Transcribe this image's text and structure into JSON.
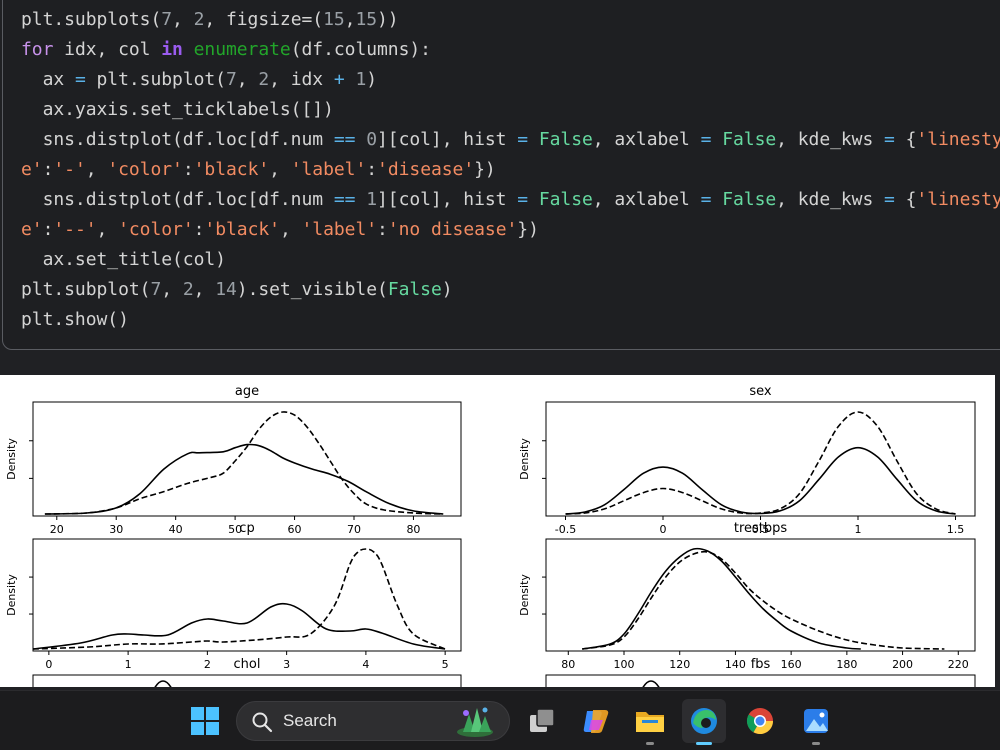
{
  "code_cell": {
    "lines": [
      [
        {
          "t": "plt.subplots(",
          "c": ""
        },
        {
          "t": "7",
          "c": "num"
        },
        {
          "t": ", ",
          "c": ""
        },
        {
          "t": "2",
          "c": "num"
        },
        {
          "t": ", figsize=(",
          "c": ""
        },
        {
          "t": "15",
          "c": "num"
        },
        {
          "t": ",",
          "c": ""
        },
        {
          "t": "15",
          "c": "num"
        },
        {
          "t": "))",
          "c": ""
        }
      ],
      [
        {
          "t": "for",
          "c": "kw"
        },
        {
          "t": " idx, col ",
          "c": ""
        },
        {
          "t": "in",
          "c": "kw2"
        },
        {
          "t": " ",
          "c": ""
        },
        {
          "t": "enumerate",
          "c": "bi"
        },
        {
          "t": "(df.columns):",
          "c": ""
        }
      ],
      [
        {
          "t": "  ax ",
          "c": ""
        },
        {
          "t": "=",
          "c": "op"
        },
        {
          "t": " plt.subplot(",
          "c": ""
        },
        {
          "t": "7",
          "c": "num"
        },
        {
          "t": ", ",
          "c": ""
        },
        {
          "t": "2",
          "c": "num"
        },
        {
          "t": ", idx ",
          "c": ""
        },
        {
          "t": "+",
          "c": "op"
        },
        {
          "t": " ",
          "c": ""
        },
        {
          "t": "1",
          "c": "num"
        },
        {
          "t": ")",
          "c": ""
        }
      ],
      [
        {
          "t": "  ax.yaxis.set_ticklabels([])",
          "c": ""
        }
      ],
      [
        {
          "t": "  sns.distplot(df.loc[df.num ",
          "c": ""
        },
        {
          "t": "==",
          "c": "op"
        },
        {
          "t": " ",
          "c": ""
        },
        {
          "t": "0",
          "c": "num"
        },
        {
          "t": "][col], hist ",
          "c": ""
        },
        {
          "t": "=",
          "c": "op"
        },
        {
          "t": " ",
          "c": ""
        },
        {
          "t": "False",
          "c": "boo"
        },
        {
          "t": ", axlabel ",
          "c": ""
        },
        {
          "t": "=",
          "c": "op"
        },
        {
          "t": " ",
          "c": ""
        },
        {
          "t": "False",
          "c": "boo"
        },
        {
          "t": ", kde_kws ",
          "c": ""
        },
        {
          "t": "=",
          "c": "op"
        },
        {
          "t": " {",
          "c": ""
        },
        {
          "t": "'linestyl",
          "c": "str"
        }
      ],
      [
        {
          "t": "e'",
          "c": "str"
        },
        {
          "t": ":",
          "c": ""
        },
        {
          "t": "'-'",
          "c": "str"
        },
        {
          "t": ", ",
          "c": ""
        },
        {
          "t": "'color'",
          "c": "str"
        },
        {
          "t": ":",
          "c": ""
        },
        {
          "t": "'black'",
          "c": "str"
        },
        {
          "t": ", ",
          "c": ""
        },
        {
          "t": "'label'",
          "c": "str"
        },
        {
          "t": ":",
          "c": ""
        },
        {
          "t": "'disease'",
          "c": "str"
        },
        {
          "t": "})",
          "c": ""
        }
      ],
      [
        {
          "t": "  sns.distplot(df.loc[df.num ",
          "c": ""
        },
        {
          "t": "==",
          "c": "op"
        },
        {
          "t": " ",
          "c": ""
        },
        {
          "t": "1",
          "c": "num"
        },
        {
          "t": "][col], hist ",
          "c": ""
        },
        {
          "t": "=",
          "c": "op"
        },
        {
          "t": " ",
          "c": ""
        },
        {
          "t": "False",
          "c": "boo"
        },
        {
          "t": ", axlabel ",
          "c": ""
        },
        {
          "t": "=",
          "c": "op"
        },
        {
          "t": " ",
          "c": ""
        },
        {
          "t": "False",
          "c": "boo"
        },
        {
          "t": ", kde_kws ",
          "c": ""
        },
        {
          "t": "=",
          "c": "op"
        },
        {
          "t": " {",
          "c": ""
        },
        {
          "t": "'linestyl",
          "c": "str"
        }
      ],
      [
        {
          "t": "e'",
          "c": "str"
        },
        {
          "t": ":",
          "c": ""
        },
        {
          "t": "'--'",
          "c": "str"
        },
        {
          "t": ", ",
          "c": ""
        },
        {
          "t": "'color'",
          "c": "str"
        },
        {
          "t": ":",
          "c": ""
        },
        {
          "t": "'black'",
          "c": "str"
        },
        {
          "t": ", ",
          "c": ""
        },
        {
          "t": "'label'",
          "c": "str"
        },
        {
          "t": ":",
          "c": ""
        },
        {
          "t": "'no disease'",
          "c": "str"
        },
        {
          "t": "})",
          "c": ""
        }
      ],
      [
        {
          "t": "  ax.set_title(col)",
          "c": ""
        }
      ],
      [
        {
          "t": "plt.subplot(",
          "c": ""
        },
        {
          "t": "7",
          "c": "num"
        },
        {
          "t": ", ",
          "c": ""
        },
        {
          "t": "2",
          "c": "num"
        },
        {
          "t": ", ",
          "c": ""
        },
        {
          "t": "14",
          "c": "num"
        },
        {
          "t": ").set_visible(",
          "c": ""
        },
        {
          "t": "False",
          "c": "boo"
        },
        {
          "t": ")",
          "c": ""
        }
      ],
      [
        {
          "t": "plt.show()",
          "c": ""
        }
      ]
    ]
  },
  "chart_data": [
    {
      "type": "line",
      "title": "age",
      "ylabel": "Density",
      "xlim": [
        16,
        88
      ],
      "ylim": [
        0,
        1
      ],
      "xticks": [
        20,
        30,
        40,
        50,
        60,
        70,
        80
      ],
      "series": [
        {
          "style": "solid",
          "x": [
            18,
            25,
            30,
            34,
            38,
            42,
            44,
            48,
            50,
            52,
            54,
            56,
            58,
            60,
            63,
            66,
            69,
            72,
            76,
            80,
            85
          ],
          "y": [
            0,
            0.01,
            0.06,
            0.2,
            0.44,
            0.59,
            0.6,
            0.61,
            0.65,
            0.68,
            0.67,
            0.62,
            0.55,
            0.5,
            0.44,
            0.39,
            0.32,
            0.22,
            0.1,
            0.03,
            0
          ]
        },
        {
          "style": "dashed",
          "x": [
            18,
            25,
            30,
            34,
            38,
            42,
            46,
            48,
            50,
            52,
            54,
            56,
            58,
            60,
            62,
            64,
            66,
            68,
            70,
            72,
            75,
            80,
            85
          ],
          "y": [
            0,
            0.01,
            0.06,
            0.15,
            0.22,
            0.3,
            0.36,
            0.4,
            0.52,
            0.66,
            0.83,
            0.95,
            1,
            0.97,
            0.86,
            0.7,
            0.52,
            0.34,
            0.2,
            0.1,
            0.04,
            0.01,
            0
          ]
        }
      ]
    },
    {
      "type": "line",
      "title": "sex",
      "ylabel": "Density",
      "xlim": [
        -0.6,
        1.6
      ],
      "ylim": [
        0,
        1
      ],
      "xticks": [
        -0.5,
        0.0,
        0.5,
        1.0,
        1.5
      ],
      "series": [
        {
          "style": "solid",
          "x": [
            -0.5,
            -0.4,
            -0.3,
            -0.2,
            -0.1,
            0,
            0.1,
            0.2,
            0.3,
            0.4,
            0.5,
            0.6,
            0.7,
            0.8,
            0.9,
            1.0,
            1.1,
            1.2,
            1.3,
            1.4,
            1.5
          ],
          "y": [
            0,
            0.02,
            0.09,
            0.24,
            0.4,
            0.46,
            0.4,
            0.24,
            0.09,
            0.02,
            0.005,
            0.03,
            0.13,
            0.34,
            0.56,
            0.65,
            0.56,
            0.34,
            0.13,
            0.03,
            0
          ]
        },
        {
          "style": "dashed",
          "x": [
            -0.5,
            -0.4,
            -0.3,
            -0.2,
            -0.1,
            0,
            0.1,
            0.2,
            0.3,
            0.4,
            0.5,
            0.6,
            0.7,
            0.8,
            0.9,
            1.0,
            1.1,
            1.2,
            1.3,
            1.4,
            1.5
          ],
          "y": [
            0,
            0.01,
            0.05,
            0.13,
            0.21,
            0.25,
            0.21,
            0.13,
            0.05,
            0.01,
            0.01,
            0.05,
            0.2,
            0.52,
            0.86,
            1,
            0.86,
            0.52,
            0.2,
            0.05,
            0
          ]
        }
      ]
    },
    {
      "type": "line",
      "title": "cp",
      "ylabel": "Density",
      "xlim": [
        -0.2,
        5.2
      ],
      "ylim": [
        0,
        1
      ],
      "xticks": [
        0,
        1,
        2,
        3,
        4,
        5
      ],
      "series": [
        {
          "style": "solid",
          "x": [
            -0.2,
            0.4,
            0.8,
            1,
            1.2,
            1.5,
            1.8,
            2,
            2.2,
            2.5,
            2.8,
            3,
            3.2,
            3.5,
            3.8,
            4,
            4.2,
            4.6,
            5
          ],
          "y": [
            0,
            0.06,
            0.14,
            0.15,
            0.14,
            0.14,
            0.26,
            0.3,
            0.28,
            0.26,
            0.42,
            0.45,
            0.38,
            0.2,
            0.18,
            0.2,
            0.16,
            0.05,
            0
          ]
        },
        {
          "style": "dashed",
          "x": [
            -0.2,
            0.5,
            1,
            1.4,
            1.8,
            2,
            2.2,
            2.6,
            3,
            3.3,
            3.6,
            3.8,
            3.9,
            4,
            4.1,
            4.2,
            4.4,
            4.6,
            5
          ],
          "y": [
            0,
            0.02,
            0.05,
            0.05,
            0.07,
            0.08,
            0.07,
            0.09,
            0.12,
            0.15,
            0.43,
            0.85,
            0.97,
            1,
            0.97,
            0.85,
            0.43,
            0.15,
            0
          ]
        }
      ]
    },
    {
      "type": "line",
      "title": "trestbps",
      "ylabel": "Density",
      "xlim": [
        72,
        226
      ],
      "ylim": [
        0,
        1
      ],
      "xticks": [
        80,
        100,
        120,
        140,
        160,
        180,
        200,
        220
      ],
      "series": [
        {
          "style": "solid",
          "x": [
            85,
            95,
            100,
            105,
            110,
            115,
            120,
            125,
            130,
            135,
            140,
            145,
            150,
            155,
            160,
            170,
            180,
            185
          ],
          "y": [
            0,
            0.05,
            0.15,
            0.35,
            0.58,
            0.78,
            0.92,
            1,
            0.98,
            0.88,
            0.72,
            0.55,
            0.4,
            0.28,
            0.18,
            0.06,
            0.01,
            0
          ]
        },
        {
          "style": "dashed",
          "x": [
            85,
            95,
            100,
            105,
            110,
            115,
            120,
            125,
            130,
            135,
            140,
            145,
            150,
            155,
            160,
            170,
            180,
            190,
            200,
            215
          ],
          "y": [
            0,
            0.04,
            0.12,
            0.3,
            0.52,
            0.72,
            0.87,
            0.95,
            0.97,
            0.9,
            0.76,
            0.6,
            0.48,
            0.38,
            0.3,
            0.18,
            0.09,
            0.04,
            0.01,
            0
          ]
        }
      ]
    },
    {
      "type": "line",
      "title": "chol",
      "ylabel": "",
      "partial": true
    },
    {
      "type": "line",
      "title": "fbs",
      "ylabel": "",
      "partial": true
    }
  ],
  "taskbar": {
    "search_label": "Search",
    "accent_color": "#60cdff"
  }
}
